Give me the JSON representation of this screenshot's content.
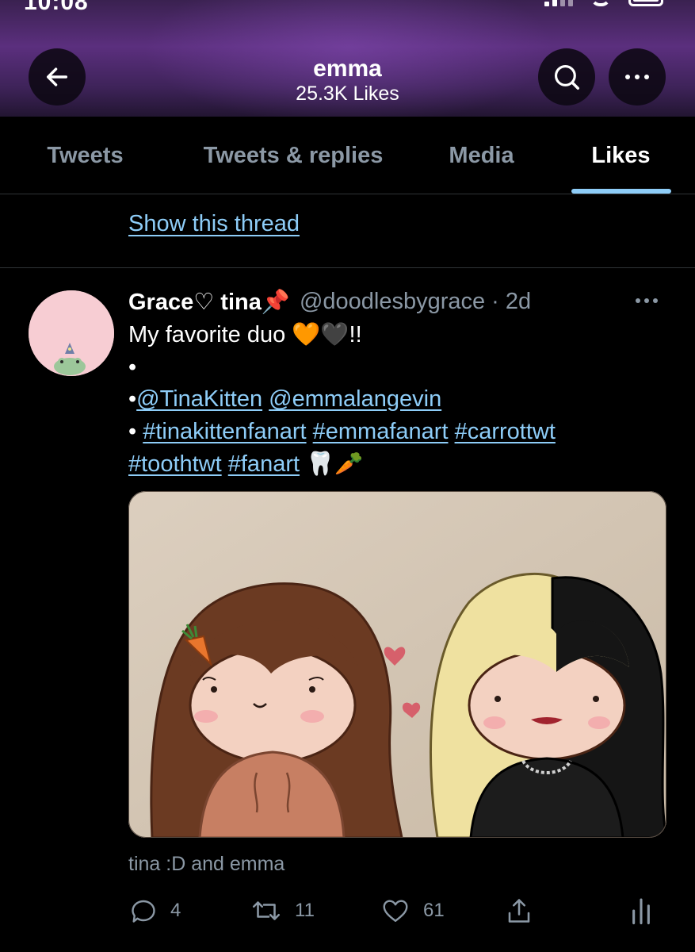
{
  "status_bar": {
    "time": "10:08"
  },
  "header": {
    "profile_name": "emma",
    "likes_count_label": "25.3K Likes"
  },
  "tabs": [
    {
      "label": "Tweets",
      "selected": false
    },
    {
      "label": "Tweets & replies",
      "selected": false
    },
    {
      "label": "Media",
      "selected": false
    },
    {
      "label": "Likes",
      "selected": true
    }
  ],
  "thread": {
    "show_thread_label": "Show this thread"
  },
  "tweet": {
    "author_name": "Grace♡ tina📌",
    "author_handle": "@doodlesbygrace",
    "separator": "·",
    "time_ago": "2d",
    "text_line1": "My favorite duo 🧡🖤!!",
    "bullet": "•",
    "mention1": "@TinaKitten",
    "mention2": "@emmalangevin",
    "hashtag1": "#tinakittenfanart",
    "hashtag2": "#emmafanart",
    "hashtag3": "#carrottwt",
    "hashtag4": "#toothtwt",
    "hashtag5": "#fanart",
    "trailing_emoji": "🦷🥕",
    "image_alt_caption": "tina :D and emma",
    "reply_count": "4",
    "retweet_count": "11",
    "like_count": "61"
  },
  "colors": {
    "accent": "#8ecdf8",
    "header_purple": "#5b2f7e",
    "muted_text": "#8b98a5",
    "background": "#000000"
  },
  "icons": [
    "back-arrow-icon",
    "search-icon",
    "more-icon",
    "reply-icon",
    "retweet-icon",
    "heart-icon",
    "share-icon",
    "analytics-icon"
  ]
}
